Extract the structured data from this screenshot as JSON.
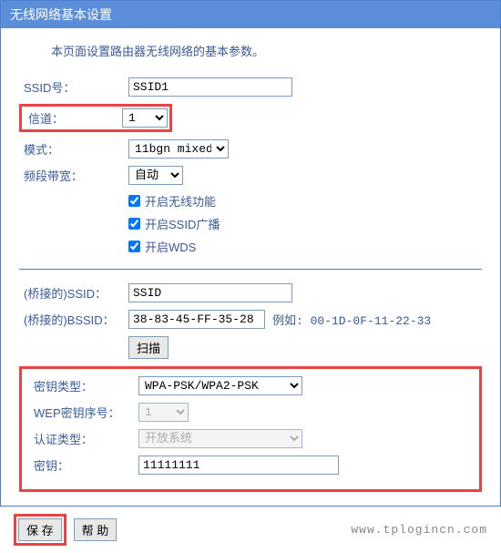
{
  "title": "无线网络基本设置",
  "desc": "本页面设置路由器无线网络的基本参数。",
  "labels": {
    "ssid": "SSID号：",
    "channel": "信道：",
    "mode": "模式：",
    "bandwidth": "频段带宽：",
    "bridged_ssid": "(桥接的)SSID：",
    "bridged_bssid": "(桥接的)BSSID：",
    "key_type": "密钥类型：",
    "wep_index": "WEP密钥序号：",
    "auth_type": "认证类型：",
    "key": "密钥："
  },
  "values": {
    "ssid": "SSID1",
    "channel": "1",
    "mode": "11bgn mixed",
    "bandwidth": "自动",
    "bridged_ssid": "SSID",
    "bridged_bssid": "38-83-45-FF-35-28",
    "key_type": "WPA-PSK/WPA2-PSK",
    "wep_index": "1",
    "auth_type": "开放系统",
    "key": "11111111"
  },
  "checkboxes": {
    "enable_wireless": "开启无线功能",
    "enable_ssid_broadcast": "开启SSID广播",
    "enable_wds": "开启WDS"
  },
  "hints": {
    "bssid_example": "例如: 00-1D-0F-11-22-33"
  },
  "buttons": {
    "scan": "扫描",
    "save": "保 存",
    "help": "帮 助"
  },
  "watermark": "www.tplogincn.com"
}
